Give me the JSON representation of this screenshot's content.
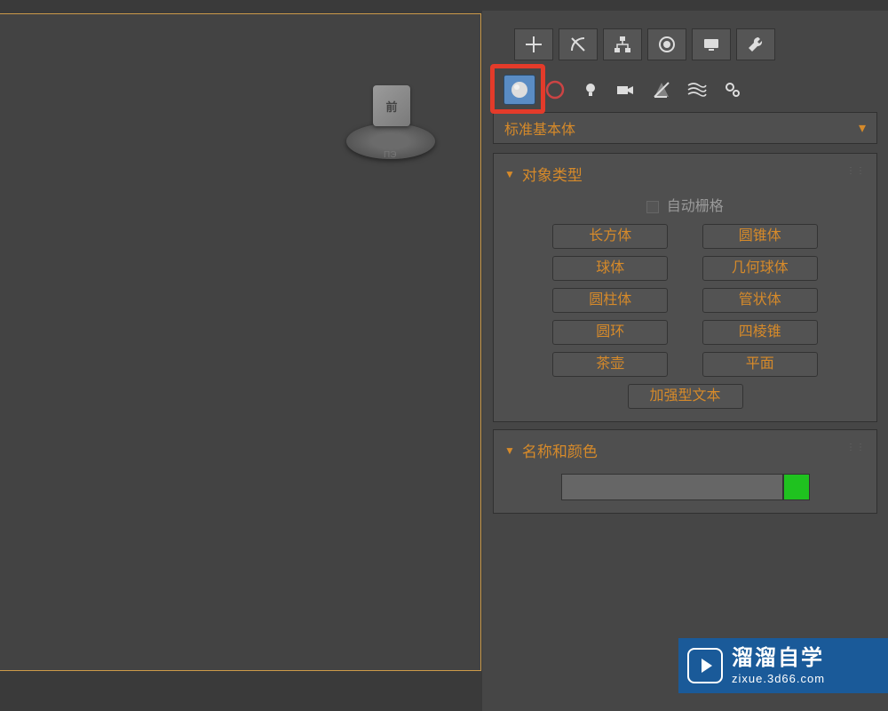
{
  "viewport": {
    "cube_face": "前",
    "ring_label": "ПЭ"
  },
  "panel": {
    "dropdown_label": "标准基本体",
    "dropdown_arrow": "▾"
  },
  "rollout_type": {
    "title": "对象类型",
    "autogrid": "自动栅格",
    "buttons": [
      "长方体",
      "圆锥体",
      "球体",
      "几何球体",
      "圆柱体",
      "管状体",
      "圆环",
      "四棱锥",
      "茶壶",
      "平面",
      "加强型文本"
    ]
  },
  "rollout_name": {
    "title": "名称和颜色",
    "color": "#1fc21f"
  },
  "watermark": {
    "title": "溜溜自学",
    "sub": "zixue.3d66.com"
  }
}
